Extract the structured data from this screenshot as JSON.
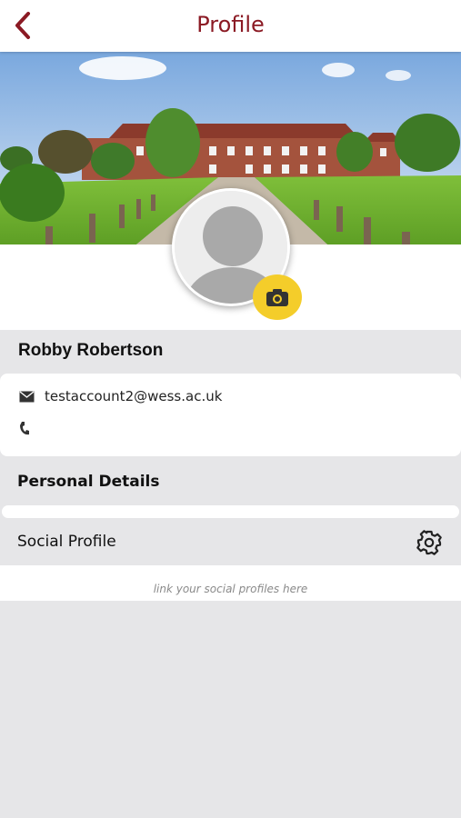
{
  "header": {
    "title": "Profile"
  },
  "colors": {
    "brand": "#8b1a24",
    "camera": "#f4cd2a",
    "background": "#e6e6e8"
  },
  "icons": {
    "back": "chevron-left-icon",
    "camera": "camera-icon",
    "email": "envelope-icon",
    "phone": "phone-icon",
    "settings": "gear-icon"
  },
  "profile": {
    "name": "Robby Robertson",
    "email": "testaccount2@wess.ac.uk",
    "phone": ""
  },
  "sections": {
    "personal_details": "Personal Details",
    "social_profile": "Social Profile",
    "social_hint": "link your social profiles here"
  }
}
